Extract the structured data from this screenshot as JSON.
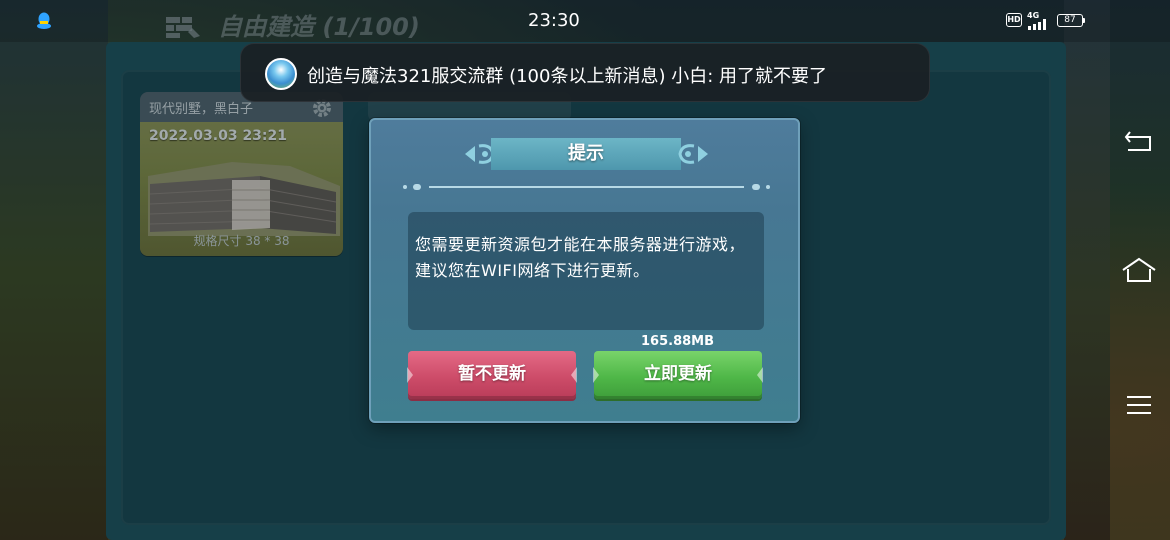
{
  "status_bar": {
    "time": "23:30",
    "network": "4G",
    "hd": "HD",
    "battery": "87"
  },
  "notification": {
    "text": "创造与魔法321服交流群 (100条以上新消息) 小白: 用了就不要了"
  },
  "header": {
    "title": "自由建造 (1/100)"
  },
  "save_card": {
    "name": "现代别墅，黑白子",
    "date": "2022.03.03 23:21",
    "size": "规格尺寸 38 * 38"
  },
  "dialog": {
    "title": "提示",
    "message": "您需要更新资源包才能在本服务器进行游戏，建议您在WIFI网络下进行更新。",
    "download_size": "165.88MB",
    "cancel_label": "暂不更新",
    "confirm_label": "立即更新"
  },
  "nav": {
    "back_icon": "back-icon",
    "home_icon": "home-icon",
    "menu_icon": "menu-icon"
  }
}
